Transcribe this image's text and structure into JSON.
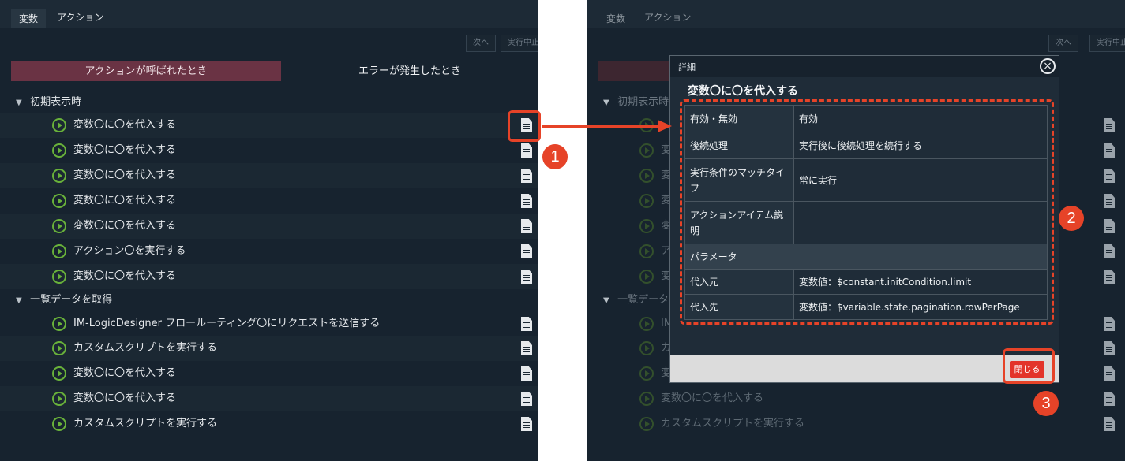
{
  "tabs": {
    "variables": "変数",
    "actions": "アクション"
  },
  "toolbar": {
    "next": "次へ",
    "stop": "実行中止"
  },
  "segments": {
    "called": "アクションが呼ばれたとき",
    "error": "エラーが発生したとき"
  },
  "groups": {
    "init": "初期表示時",
    "fetch": "一覧データを取得"
  },
  "items": [
    "変数〇に〇を代入する",
    "変数〇に〇を代入する",
    "変数〇に〇を代入する",
    "変数〇に〇を代入する",
    "変数〇に〇を代入する",
    "アクション〇を実行する",
    "変数〇に〇を代入する",
    "IM-LogicDesigner フロールーティング〇にリクエストを送信する",
    "カスタムスクリプトを実行する",
    "変数〇に〇を代入する",
    "変数〇に〇を代入する",
    "カスタムスクリプトを実行する"
  ],
  "right_items": [
    "変数〇に〇を代入する",
    "カスタムスクリプトを実行する"
  ],
  "right_fragments": {
    "prefix_change": "変",
    "prefix_action": "ア",
    "prefix_custom": "カ",
    "prefix_im": "IM",
    "prefix_init": "初期表示時",
    "prefix_fetch": "一覧データ"
  },
  "modal": {
    "title": "詳細",
    "close_symbol": "×",
    "heading": "変数〇に〇を代入する",
    "rows": [
      {
        "key": "有効・無効",
        "value": "有効"
      },
      {
        "key": "後続処理",
        "value": "実行後に後続処理を続行する"
      },
      {
        "key": "実行条件のマッチタイプ",
        "value": "常に実行"
      },
      {
        "key": "アクションアイテム説明",
        "value": ""
      }
    ],
    "section": "パラメータ",
    "param_rows": [
      {
        "key": "代入元",
        "value": "変数値：$constant.initCondition.limit"
      },
      {
        "key": "代入先",
        "value": "変数値：$variable.state.pagination.rowPerPage"
      }
    ],
    "close_button": "閉じる"
  },
  "badges": [
    "1",
    "2",
    "3"
  ],
  "colors": {
    "background": "#17232f",
    "accent_red": "#e64328",
    "play_green": "#69b23a",
    "segment_active": "#6a3344"
  }
}
